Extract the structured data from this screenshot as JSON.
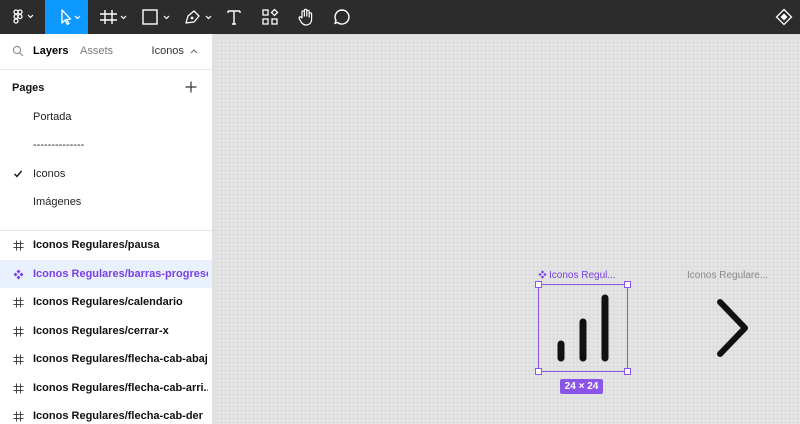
{
  "toolbar": {
    "tools": [
      "figma-menu",
      "move",
      "frame",
      "shape",
      "pen",
      "text",
      "resources",
      "hand",
      "comment"
    ],
    "active_tool": "move",
    "accent": "#0d99ff"
  },
  "panel": {
    "tabs": {
      "layers": "Layers",
      "assets": "Assets"
    },
    "current_page": "Iconos",
    "pages_header": "Pages",
    "pages": [
      "Portada",
      "--------------",
      "Iconos",
      "Imágenes"
    ],
    "selected_page": "Iconos",
    "layers": [
      "Iconos Regulares/pausa",
      "Iconos Regulares/barras-progreso",
      "Iconos Regulares/calendario",
      "Iconos Regulares/cerrar-x",
      "Iconos Regulares/flecha-cab-abajo",
      "Iconos Regulares/flecha-cab-arri...",
      "Iconos Regulares/flecha-cab-der"
    ],
    "selected_layer": "Iconos Regulares/barras-progreso",
    "selection_color": "#7b40e6"
  },
  "canvas": {
    "frames": [
      {
        "label": "Iconos Regul...",
        "selected": true
      },
      {
        "label": "Iconos Regulare...",
        "selected": false
      }
    ],
    "size_badge": "24 × 24"
  }
}
